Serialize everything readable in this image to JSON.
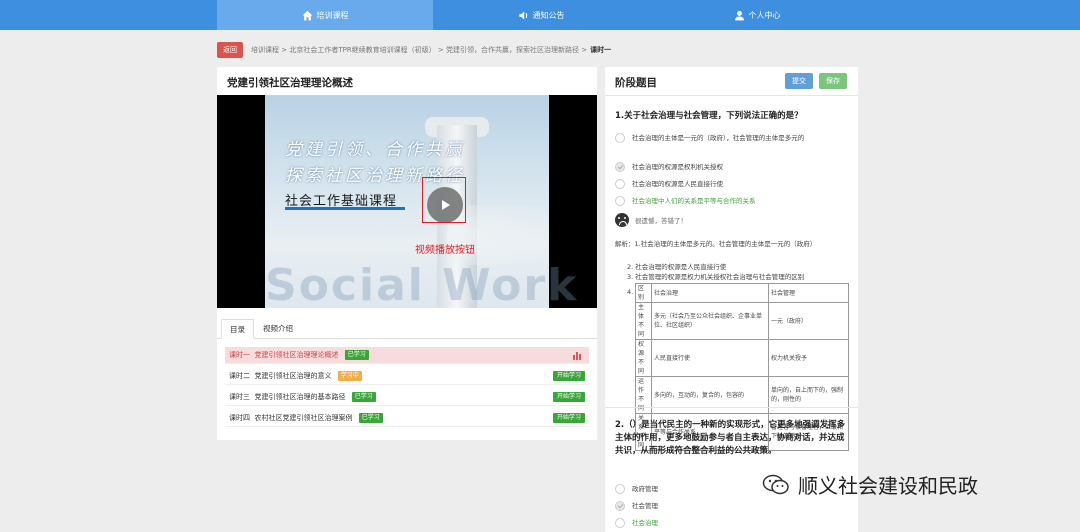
{
  "nav": {
    "items": [
      {
        "label": "培训课程",
        "icon": "home-icon",
        "active": true
      },
      {
        "label": "通知公告",
        "icon": "speaker-icon",
        "active": false
      },
      {
        "label": "个人中心",
        "icon": "user-icon",
        "active": false
      }
    ]
  },
  "breadcrumb": {
    "back_label": "返回",
    "path": "培训课程 > 北京社会工作者TPR继续教育培训课程（初级） > 党建引领，合作共赢，探索社区治理新路径 >",
    "current": "课时一"
  },
  "course": {
    "title": "党建引领社区治理理论概述",
    "video": {
      "line1": "党建引领、合作共赢",
      "line2": "探索社区治理新路径",
      "line3": "社会工作基础课程",
      "watermark": "Social Work",
      "play_label": "视频播放按钮"
    },
    "tabs": [
      "目录",
      "视频介绍"
    ],
    "lessons": [
      {
        "num": "课时一",
        "title": "党建引领社区治理理论概述",
        "badge": "已学习",
        "badge_color": "green",
        "action": "",
        "active": true
      },
      {
        "num": "课时二",
        "title": "党建引领社区治理的意义",
        "badge": "学习中",
        "badge_color": "orange",
        "action": "开始学习",
        "active": false
      },
      {
        "num": "课时三",
        "title": "党建引领社区治理的基本路径",
        "badge": "已学习",
        "badge_color": "green",
        "action": "开始学习",
        "active": false
      },
      {
        "num": "课时四",
        "title": "农村社区党建引领社区治理案例",
        "badge": "已学习",
        "badge_color": "green",
        "action": "开始学习",
        "active": false
      }
    ]
  },
  "quiz": {
    "title": "阶段题目",
    "submit_label": "提交",
    "save_label": "保存",
    "q1": {
      "text": "1.关于社会治理与社会管理，下列说法正确的是？",
      "options": [
        {
          "text": "社会治理的主体是一元的（政府），社会管理的主体是多元的",
          "checked": false,
          "correct": false
        },
        {
          "text": "社会治理的权源是权利机关授权",
          "checked": true,
          "correct": false
        },
        {
          "text": "社会治理的权源是人民直接行使",
          "checked": false,
          "correct": false
        },
        {
          "text": "社会治理中人们的关系是平等与合作的关系",
          "checked": false,
          "correct": true
        }
      ],
      "feedback": "很遗憾，答错了！",
      "analysis_lines": [
        "解析：1.社会治理的主体是多元的。社会管理的主体是一元的（政府）",
        "2. 社会治理的权源是人民直接行使",
        "3. 社会管理的权源是权力机关授权社会治理与社会管理的区别",
        "4."
      ],
      "table": {
        "header": [
          "区别",
          "社会治理",
          "社会管理"
        ],
        "rows": [
          [
            "主体不同",
            "多元（社会乃至公众社会组织、企事业单位、社区组织）",
            "一元（政府）"
          ],
          [
            "权源不同",
            "人民直接行使",
            "权力机关授予"
          ],
          [
            "运作不同",
            "多向的，互动的，复合的，包容的",
            "单向的，自上而下的，强制的，刚性的"
          ],
          [
            "关系不同",
            "平等与合作关系",
            "管理者与被管理者，上级和下级的关系"
          ]
        ]
      }
    },
    "q2": {
      "text": "2.（）是当代民主的一种新的实现形式，它更多地强调发挥多主体的作用，更多地鼓励参与者自主表达，协商对话，并达成共识，从而形成符合整合利益的公共政策。",
      "options": [
        {
          "text": "政府管理",
          "checked": false,
          "correct": false
        },
        {
          "text": "社会管理",
          "checked": true,
          "correct": false
        },
        {
          "text": "社会治理",
          "checked": false,
          "correct": true
        }
      ]
    }
  },
  "watermark": {
    "text": "顺义社会建设和民政",
    "icon": "wechat-icon"
  },
  "colors": {
    "topbar": "#3f8fe0",
    "active_nav": "#68aaec",
    "red": "#e21b1b",
    "green": "#3aa63a",
    "orange": "#f0ad4e"
  }
}
